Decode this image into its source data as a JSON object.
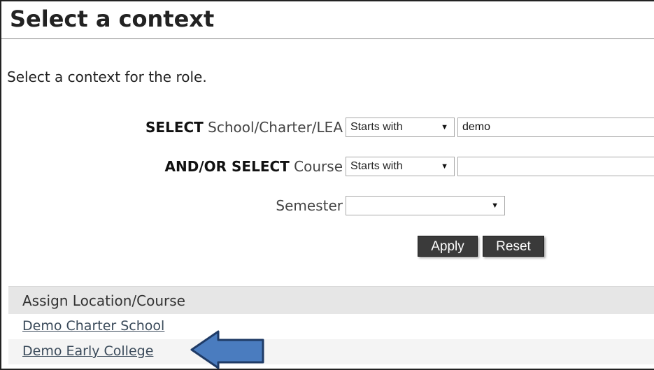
{
  "page": {
    "title": "Select a context",
    "intro": "Select a context for the role."
  },
  "filters": {
    "school": {
      "label_bold": "SELECT",
      "label_rest": "School/Charter/LEA",
      "mode": "Starts with",
      "value": "demo"
    },
    "course": {
      "label_bold": "AND/OR SELECT",
      "label_rest": "Course",
      "mode": "Starts with",
      "value": ""
    },
    "semester": {
      "label": "Semester",
      "value": ""
    },
    "apply_label": "Apply",
    "reset_label": "Reset"
  },
  "assign": {
    "header": "Assign Location/Course",
    "items": [
      {
        "label": "Demo Charter School"
      },
      {
        "label": "Demo Early College"
      }
    ]
  },
  "annotation": {
    "arrow_color": "#4a7cbf",
    "arrow_border": "#1f3b66",
    "icon": "left-arrow"
  },
  "icons": {
    "dropdown": "chevron-down-icon"
  }
}
